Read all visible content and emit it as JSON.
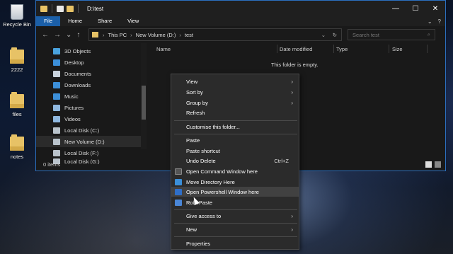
{
  "desktop": {
    "icons": [
      {
        "label": "Recycle Bin",
        "icon": "recycle-bin-icon"
      },
      {
        "label": "2222",
        "icon": "folder-icon"
      },
      {
        "label": "files",
        "icon": "folder-icon"
      },
      {
        "label": "notes",
        "icon": "folder-icon"
      }
    ]
  },
  "window": {
    "title": "D:\\test",
    "controls": {
      "minimize": "—",
      "maximize": "☐",
      "close": "✕"
    },
    "ribbon": {
      "tabs": [
        "File",
        "Home",
        "Share",
        "View"
      ],
      "expand": "⌄",
      "help": "?"
    },
    "address": {
      "crumbs": [
        "This PC",
        "New Volume (D:)",
        "test"
      ],
      "separator": "›",
      "dropdown": "⌄",
      "refresh": "↻"
    },
    "search": {
      "placeholder": "Search test",
      "icon": "⌕"
    },
    "nav_arrows": {
      "back": "←",
      "forward": "→",
      "recent": "⌄",
      "up": "↑"
    },
    "nav_pane": [
      {
        "label": "3D Objects",
        "icon": "3d-objects-icon",
        "color": "#4aa3df"
      },
      {
        "label": "Desktop",
        "icon": "desktop-icon",
        "color": "#3c8fd9"
      },
      {
        "label": "Documents",
        "icon": "documents-icon",
        "color": "#c9d3de"
      },
      {
        "label": "Downloads",
        "icon": "downloads-icon",
        "color": "#3c8fd9"
      },
      {
        "label": "Music",
        "icon": "music-icon",
        "color": "#3c8fd9"
      },
      {
        "label": "Pictures",
        "icon": "pictures-icon",
        "color": "#8fb8e0"
      },
      {
        "label": "Videos",
        "icon": "videos-icon",
        "color": "#8fb8e0"
      },
      {
        "label": "Local Disk (C:)",
        "icon": "drive-icon",
        "color": "#b9c3cc"
      },
      {
        "label": "New Volume (D:)",
        "icon": "drive-icon",
        "color": "#b9c3cc",
        "selected": true
      },
      {
        "label": "Local Disk (F:)",
        "icon": "drive-icon",
        "color": "#b9c3cc"
      },
      {
        "label": "Local Disk (G:)",
        "icon": "drive-icon",
        "color": "#b9c3cc"
      }
    ],
    "columns": [
      "Name",
      "Date modified",
      "Type",
      "Size"
    ],
    "empty_message": "This folder is empty.",
    "status": {
      "items": "0 items"
    }
  },
  "context_menu": {
    "items": [
      {
        "label": "View",
        "arrow": "›"
      },
      {
        "label": "Sort by",
        "arrow": "›"
      },
      {
        "label": "Group by",
        "arrow": "›"
      },
      {
        "label": "Refresh"
      },
      {
        "separator": true
      },
      {
        "label": "Customise this folder..."
      },
      {
        "separator": true
      },
      {
        "label": "Paste"
      },
      {
        "label": "Paste shortcut"
      },
      {
        "label": "Undo Delete",
        "shortcut": "Ctrl+Z"
      },
      {
        "label": "Open Command Window here",
        "icon": "cmd-icon",
        "color": "#555555"
      },
      {
        "label": "Move Directory Here",
        "icon": "move-directory-icon",
        "color": "#3b8fd8"
      },
      {
        "label": "Open Powershell Window here",
        "icon": "powershell-icon",
        "color": "#2f6fc8",
        "highlighted": true
      },
      {
        "label": "RoboPaste",
        "icon": "robopaste-icon",
        "color": "#4a86d6"
      },
      {
        "separator": true
      },
      {
        "label": "Give access to",
        "arrow": "›"
      },
      {
        "separator": true
      },
      {
        "label": "New",
        "arrow": "›"
      },
      {
        "separator": true
      },
      {
        "label": "Properties"
      }
    ]
  }
}
